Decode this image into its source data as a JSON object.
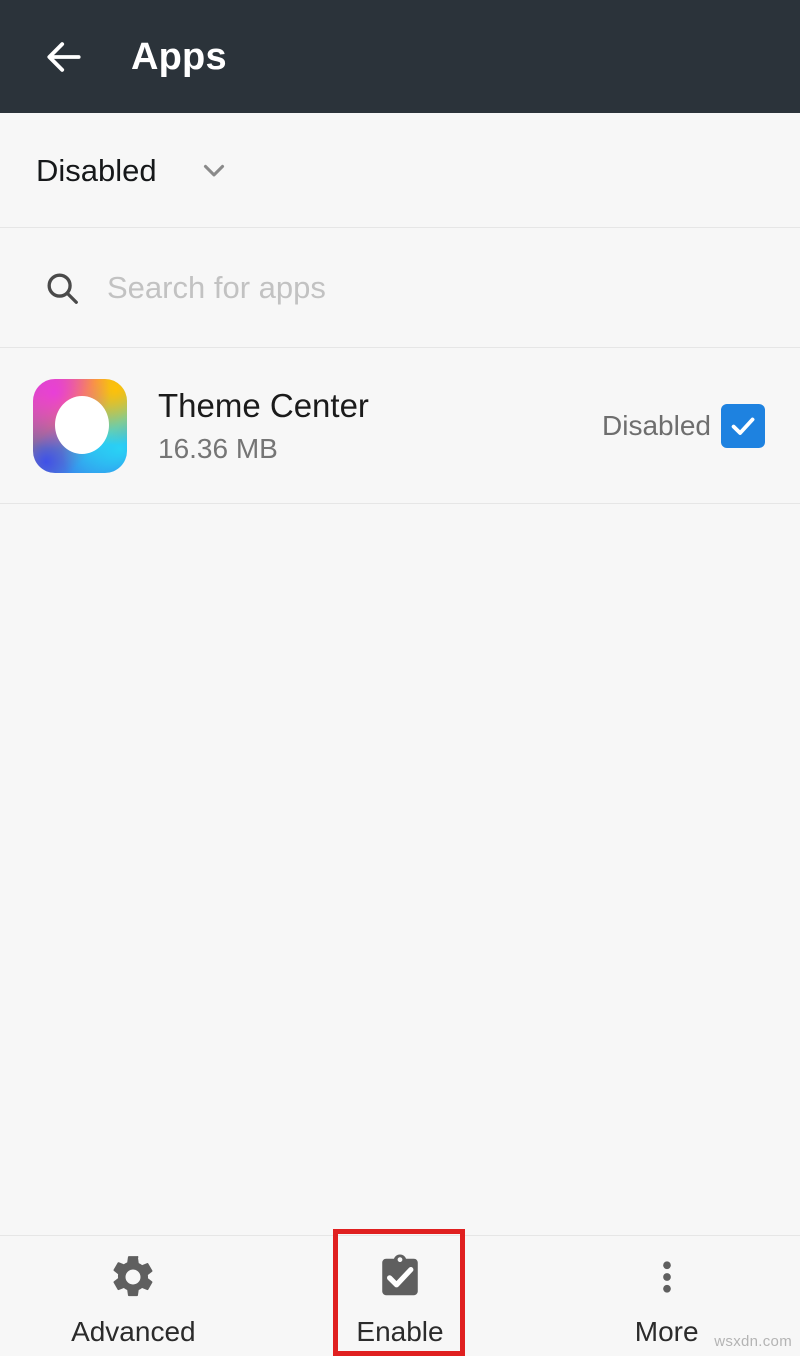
{
  "appbar": {
    "back_icon": "arrow-left-icon",
    "title": "Apps"
  },
  "filter": {
    "label": "Disabled",
    "caret_icon": "chevron-down-icon"
  },
  "search": {
    "icon": "search-icon",
    "value": "",
    "placeholder": "Search for apps"
  },
  "app_list": {
    "items": [
      {
        "icon": "theme-center-app-icon",
        "name": "Theme Center",
        "size": "16.36 MB",
        "state": "Disabled",
        "checked": true
      }
    ]
  },
  "bottombar": {
    "items": [
      {
        "icon": "gear-icon",
        "label": "Advanced",
        "highlighted": false
      },
      {
        "icon": "clipboard-check-icon",
        "label": "Enable",
        "highlighted": true
      },
      {
        "icon": "dots-vertical-icon",
        "label": "More",
        "highlighted": false
      }
    ]
  },
  "annotation": {
    "highlight_color": "#e02020",
    "target": "Enable"
  },
  "watermark": {
    "text": "wsxdn.com"
  },
  "colors": {
    "appbar_bg": "#2b333a",
    "page_bg": "#f7f7f7",
    "checkbox_blue": "#1e82e0",
    "divider": "#e6e6e6",
    "icon_gray": "#5f5f5f"
  }
}
